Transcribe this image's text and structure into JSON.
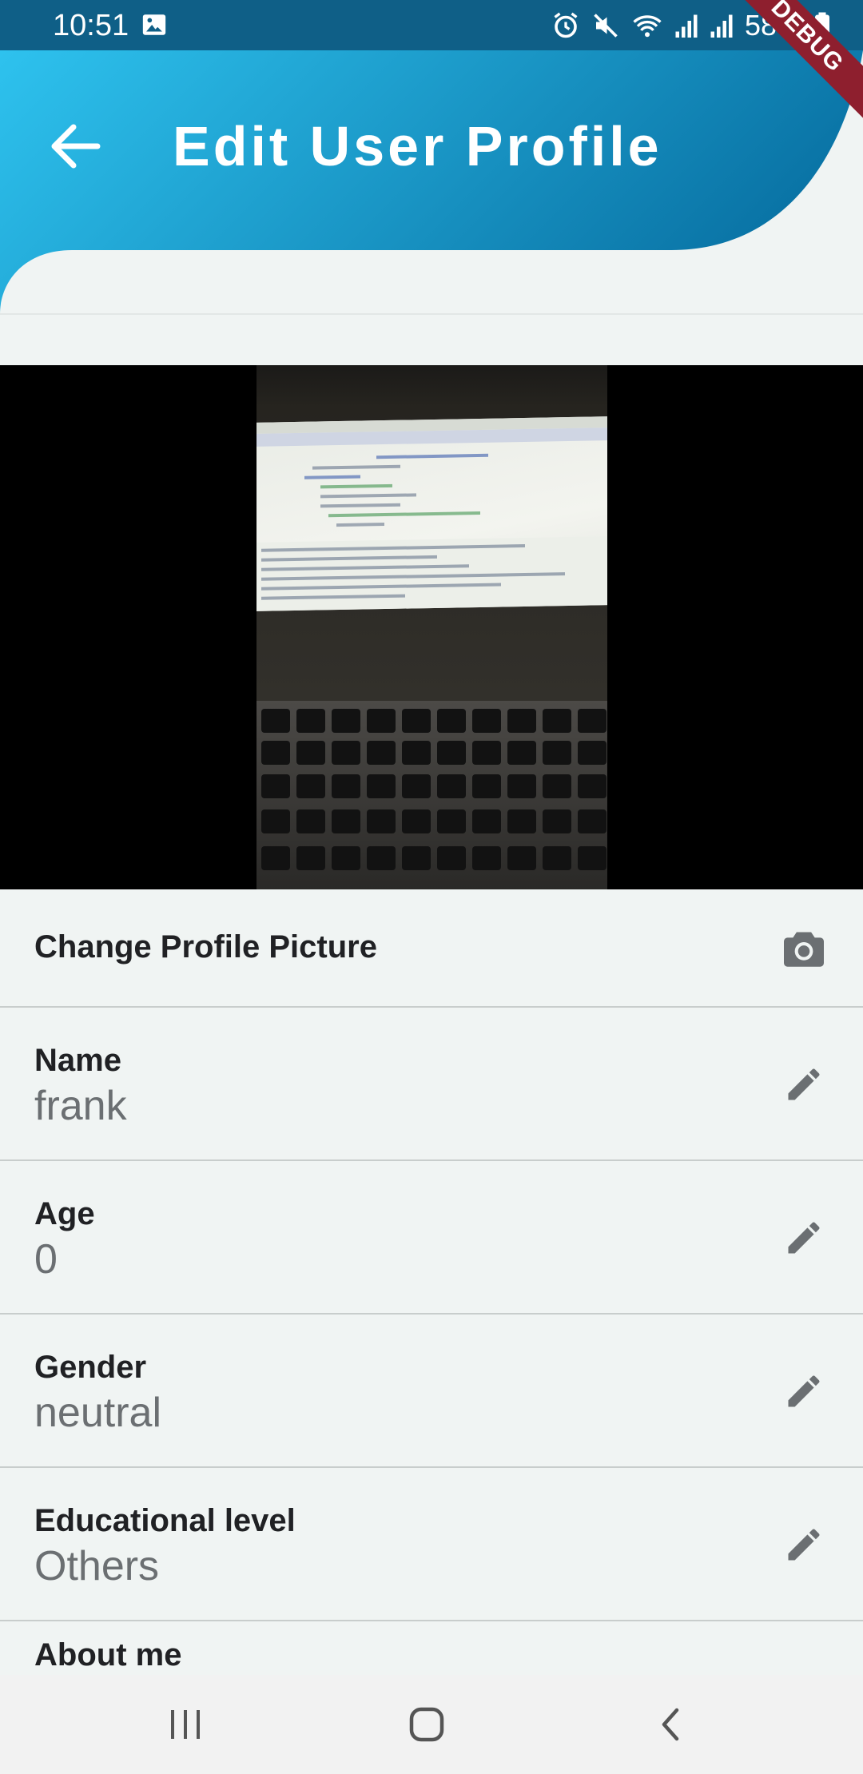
{
  "status_bar": {
    "time": "10:51",
    "battery": "58%",
    "left_icons": [
      "gallery-icon"
    ],
    "right_icons": [
      "alarm-icon",
      "mute-icon",
      "wifi-icon",
      "signal-icon",
      "signal-icon",
      "battery-icon"
    ]
  },
  "header": {
    "title": "Edit User Profile",
    "back_icon": "arrow-left-icon",
    "gradient_colors": [
      "#2ec2ee",
      "#0a74a6"
    ]
  },
  "debug_banner": "DEBUG",
  "profile_picture": {
    "change_label": "Change Profile Picture",
    "icon": "camera-icon"
  },
  "fields": [
    {
      "label": "Name",
      "value": "frank",
      "icon": "pencil-icon"
    },
    {
      "label": "Age",
      "value": "0",
      "icon": "pencil-icon"
    },
    {
      "label": "Gender",
      "value": "neutral",
      "icon": "pencil-icon"
    },
    {
      "label": "Educational level",
      "value": "Others",
      "icon": "pencil-icon"
    },
    {
      "label": "About me",
      "value": "",
      "icon": "pencil-icon"
    }
  ],
  "nav_bar": {
    "buttons": [
      "recents-icon",
      "home-icon",
      "back-icon"
    ]
  }
}
